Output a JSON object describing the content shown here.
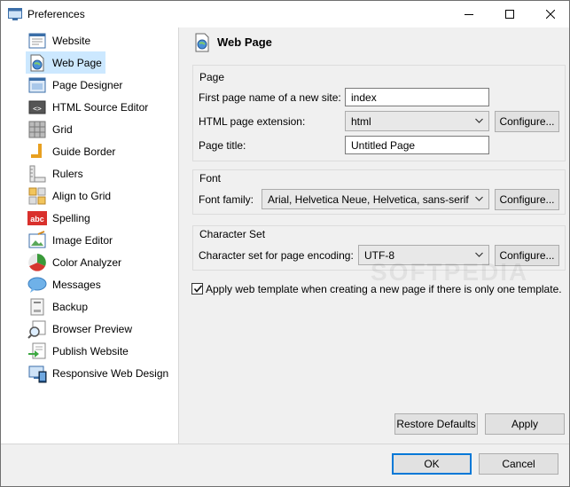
{
  "window": {
    "title": "Preferences"
  },
  "sidebar": {
    "items": [
      {
        "label": "Website",
        "icon": "website-icon"
      },
      {
        "label": "Web Page",
        "icon": "web-page-icon",
        "selected": true
      },
      {
        "label": "Page Designer",
        "icon": "page-designer-icon"
      },
      {
        "label": "HTML Source Editor",
        "icon": "html-source-editor-icon"
      },
      {
        "label": "Grid",
        "icon": "grid-icon"
      },
      {
        "label": "Guide Border",
        "icon": "guide-border-icon"
      },
      {
        "label": "Rulers",
        "icon": "rulers-icon"
      },
      {
        "label": "Align to Grid",
        "icon": "align-to-grid-icon"
      },
      {
        "label": "Spelling",
        "icon": "spelling-icon"
      },
      {
        "label": "Image Editor",
        "icon": "image-editor-icon"
      },
      {
        "label": "Color Analyzer",
        "icon": "color-analyzer-icon"
      },
      {
        "label": "Messages",
        "icon": "messages-icon"
      },
      {
        "label": "Backup",
        "icon": "backup-icon"
      },
      {
        "label": "Browser Preview",
        "icon": "browser-preview-icon"
      },
      {
        "label": "Publish Website",
        "icon": "publish-website-icon"
      },
      {
        "label": "Responsive Web Design",
        "icon": "responsive-web-design-icon"
      }
    ],
    "spelling_icon_text": "abc"
  },
  "content": {
    "title": "Web Page",
    "page_group": {
      "title": "Page",
      "first_page_label": "First page name of a new site:",
      "first_page_value": "index",
      "extension_label": "HTML page extension:",
      "extension_value": "html",
      "extension_configure": "Configure...",
      "title_label": "Page title:",
      "title_value": "Untitled Page"
    },
    "font_group": {
      "title": "Font",
      "family_label": "Font family:",
      "family_value": "Arial, Helvetica Neue, Helvetica, sans-serif",
      "configure": "Configure..."
    },
    "charset_group": {
      "title": "Character Set",
      "encoding_label": "Character set for page encoding:",
      "encoding_value": "UTF-8",
      "configure": "Configure..."
    },
    "template_checkbox": {
      "label": "Apply web template when creating a new page if there is only one template.",
      "checked": true
    },
    "restore_defaults": "Restore Defaults",
    "apply": "Apply"
  },
  "footer": {
    "ok": "OK",
    "cancel": "Cancel"
  },
  "watermark": "SOFTPEDIA",
  "colors": {
    "selection": "#cce8ff",
    "accent": "#0078d7"
  }
}
